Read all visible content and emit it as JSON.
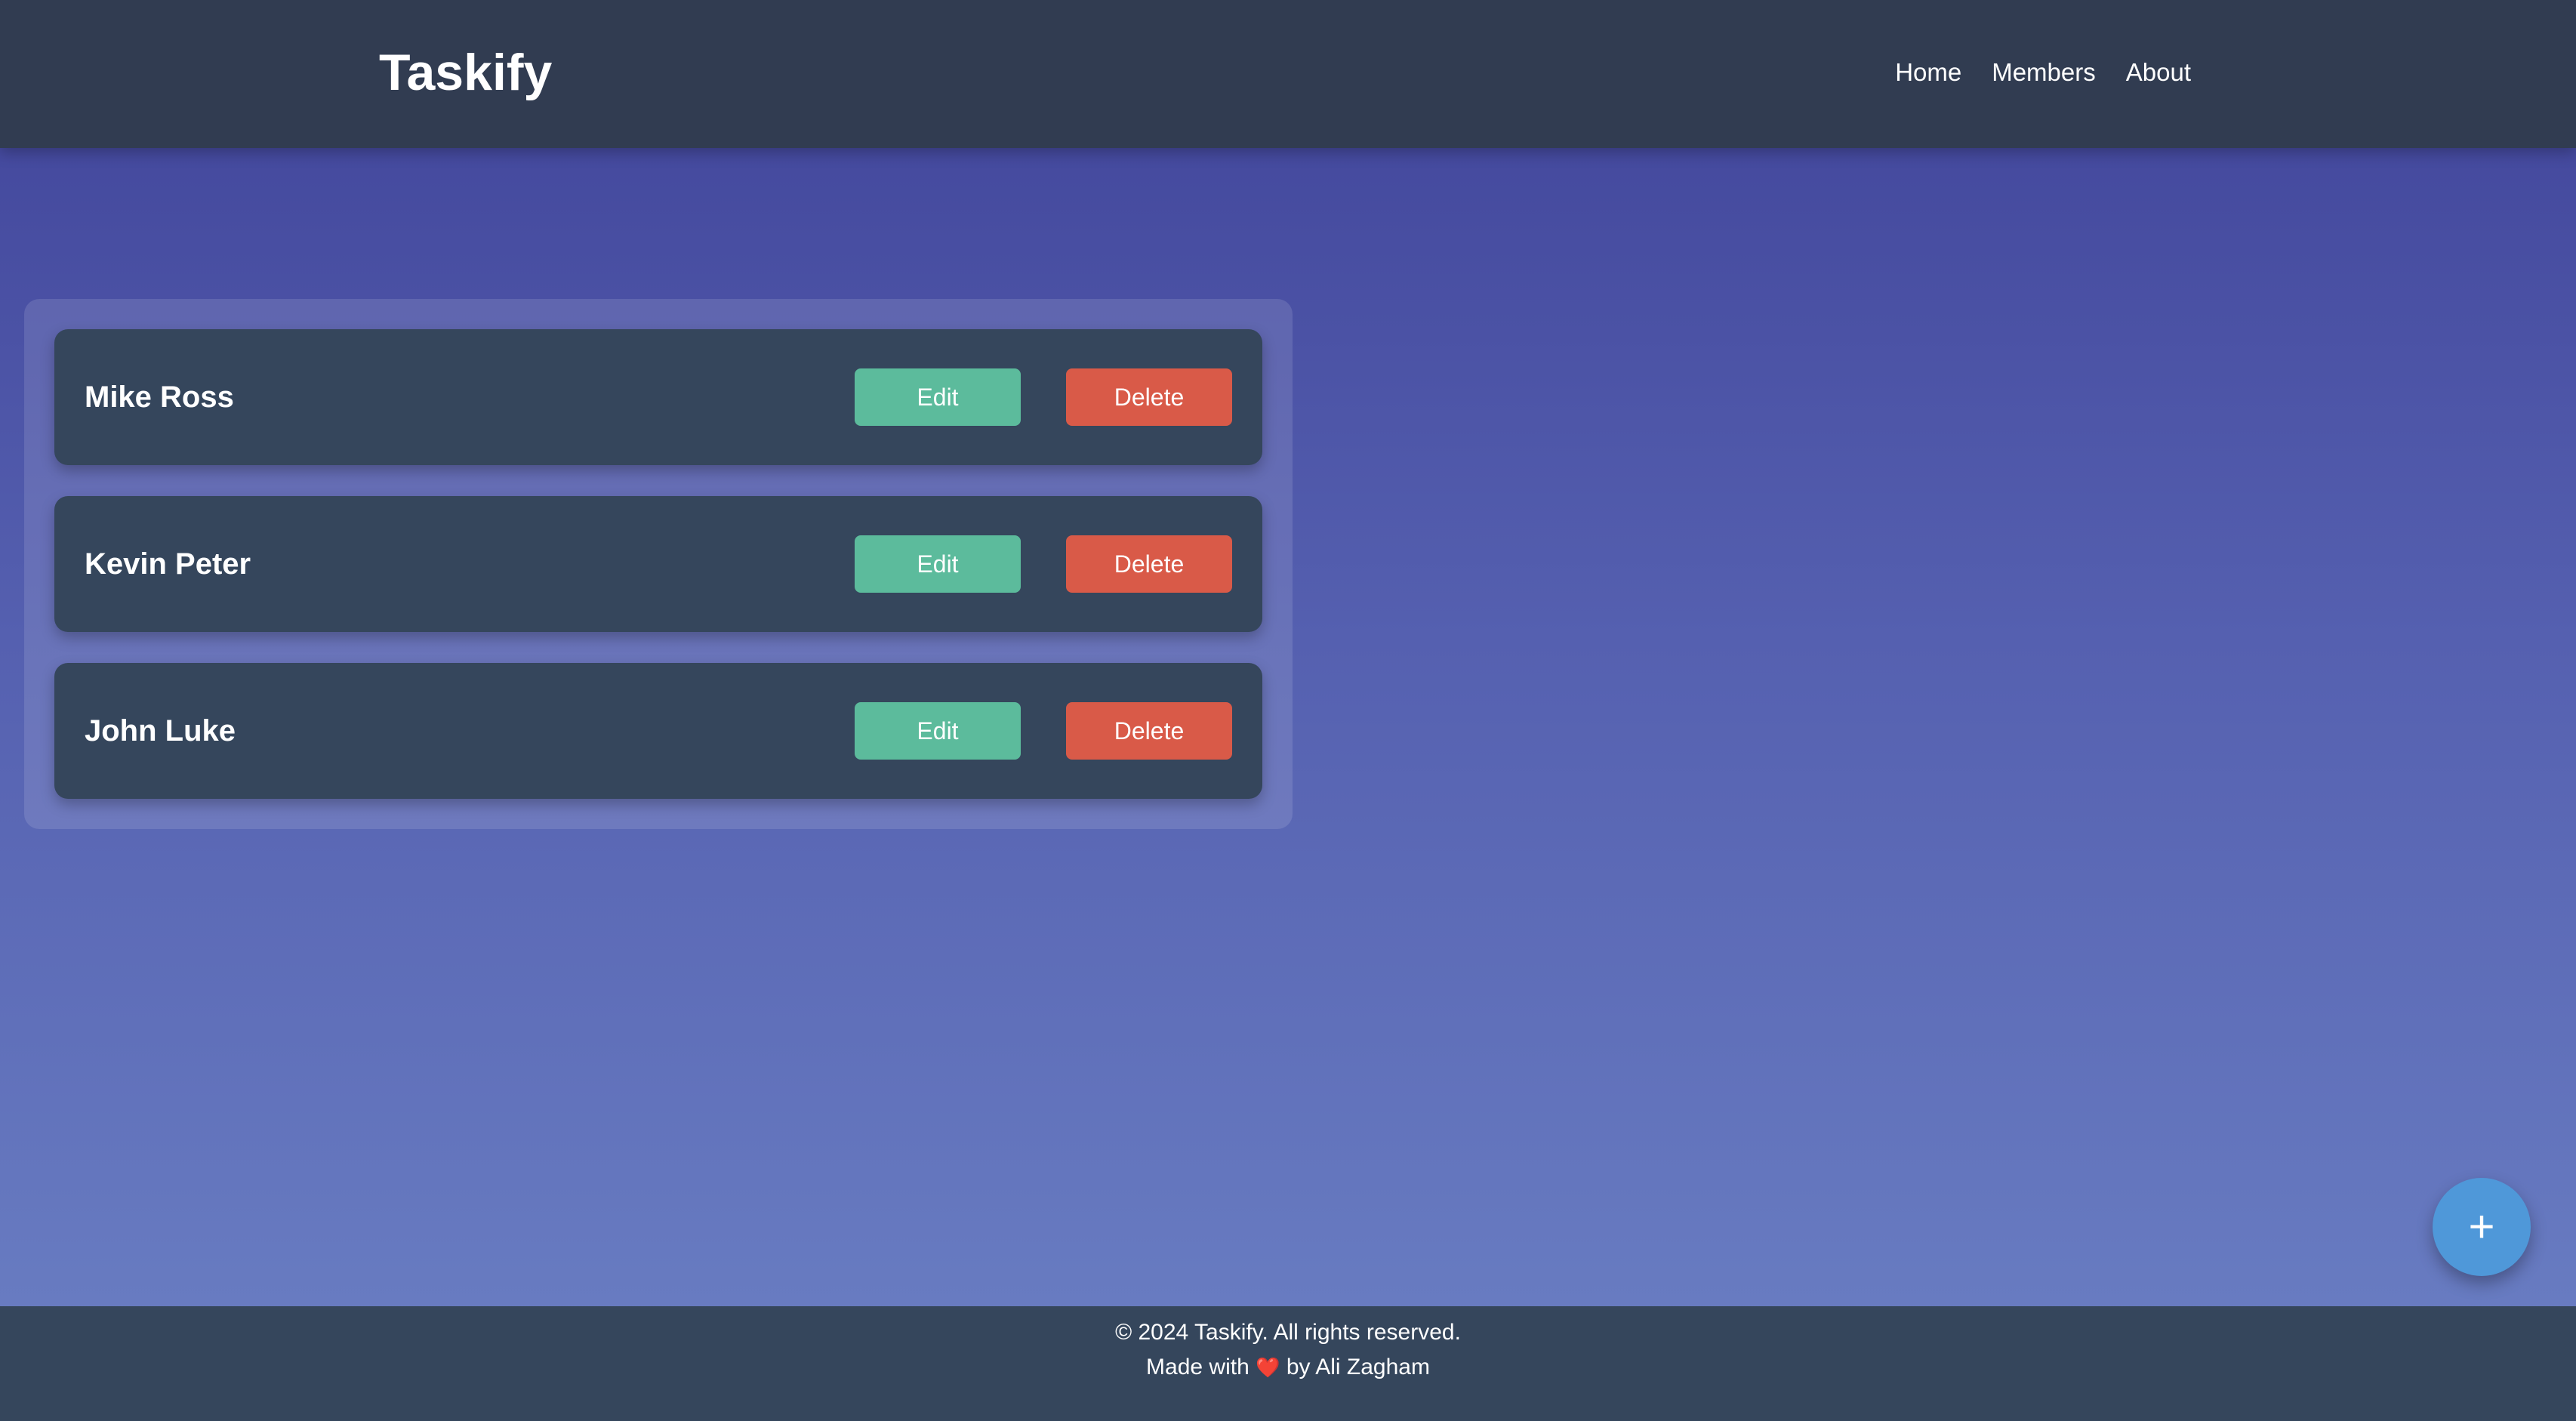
{
  "header": {
    "logo": "Taskify",
    "nav": [
      "Home",
      "Members",
      "About"
    ]
  },
  "members": [
    {
      "name": "Mike Ross",
      "edit_label": "Edit",
      "delete_label": "Delete"
    },
    {
      "name": "Kevin Peter",
      "edit_label": "Edit",
      "delete_label": "Delete"
    },
    {
      "name": "John Luke",
      "edit_label": "Edit",
      "delete_label": "Delete"
    }
  ],
  "fab": {
    "label": "+"
  },
  "footer": {
    "copyright": "© 2024 Taskify. All rights reserved.",
    "made_prefix": "Made with",
    "heart": "❤️",
    "made_suffix": "by Ali Zagham"
  },
  "colors": {
    "header_bg": "#313c51",
    "card_bg": "#35465c",
    "edit": "#5cbb9c",
    "delete": "#d95a48",
    "fab": "#4f98d9"
  }
}
